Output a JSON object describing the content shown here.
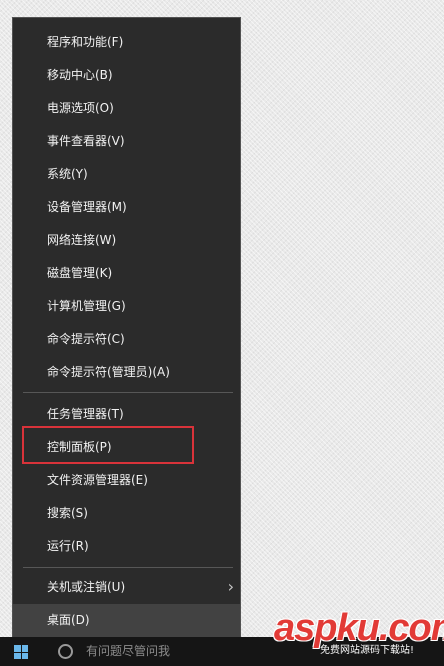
{
  "menu": {
    "items": [
      {
        "label": "程序和功能(F)"
      },
      {
        "label": "移动中心(B)"
      },
      {
        "label": "电源选项(O)"
      },
      {
        "label": "事件查看器(V)"
      },
      {
        "label": "系统(Y)"
      },
      {
        "label": "设备管理器(M)"
      },
      {
        "label": "网络连接(W)"
      },
      {
        "label": "磁盘管理(K)"
      },
      {
        "label": "计算机管理(G)"
      },
      {
        "label": "命令提示符(C)"
      },
      {
        "label": "命令提示符(管理员)(A)"
      },
      {
        "label": "任务管理器(T)"
      },
      {
        "label": "控制面板(P)"
      },
      {
        "label": "文件资源管理器(E)"
      },
      {
        "label": "搜索(S)"
      },
      {
        "label": "运行(R)"
      },
      {
        "label": "关机或注销(U)",
        "submenu_icon": "chevron-right-icon"
      },
      {
        "label": "桌面(D)",
        "state": "hovered"
      }
    ],
    "highlighted_item": "控制面板(P)",
    "highlight_color": "#d9333a"
  },
  "taskbar": {
    "search_placeholder": "有问题尽管问我",
    "start_icon": "windows-logo-icon",
    "cortana_icon": "cortana-circle-icon",
    "accent_color": "#6ab7ea"
  },
  "watermark": {
    "logo": "aspku.com",
    "tagline": "免费网站源码下载站!"
  },
  "colors": {
    "menu_background": "#2b2b2b",
    "menu_text": "#f2f2f2",
    "hover_background": "#424242"
  }
}
